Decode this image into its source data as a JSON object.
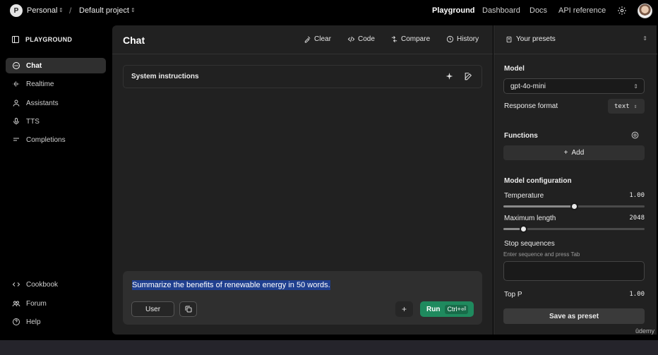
{
  "topbar": {
    "org_initial": "P",
    "org_name": "Personal",
    "separator": "/",
    "project_name": "Default project",
    "nav": [
      "Playground",
      "Dashboard",
      "Docs",
      "API reference"
    ]
  },
  "sidebar": {
    "title": "PLAYGROUND",
    "items": [
      {
        "label": "Chat",
        "icon": "chat-bubble-icon",
        "active": true
      },
      {
        "label": "Realtime",
        "icon": "waveform-icon"
      },
      {
        "label": "Assistants",
        "icon": "assistant-icon"
      },
      {
        "label": "TTS",
        "icon": "microphone-icon"
      },
      {
        "label": "Completions",
        "icon": "lines-icon"
      }
    ],
    "bottom_items": [
      {
        "label": "Cookbook",
        "icon": "code-icon"
      },
      {
        "label": "Forum",
        "icon": "people-icon"
      },
      {
        "label": "Help",
        "icon": "help-icon"
      }
    ]
  },
  "main": {
    "title": "Chat",
    "header_buttons": [
      "Clear",
      "Code",
      "Compare",
      "History"
    ],
    "system_label": "System instructions",
    "composer_text": "Summarize the benefits of renewable energy in 50 words.",
    "role_label": "User",
    "add_symbol": "+",
    "run_label": "Run",
    "run_shortcut": "Ctrl+⏎"
  },
  "right": {
    "presets_label": "Your presets",
    "model_label": "Model",
    "model_value": "gpt-4o-mini",
    "response_format_label": "Response format",
    "response_format_value": "text",
    "functions_label": "Functions",
    "add_label": "Add",
    "config_label": "Model configuration",
    "temperature_label": "Temperature",
    "temperature_value": "1.00",
    "temperature_fraction": 0.5,
    "max_length_label": "Maximum length",
    "max_length_value": "2048",
    "max_length_fraction": 0.14,
    "stop_label": "Stop sequences",
    "stop_hint": "Enter sequence and press Tab",
    "top_p_label": "Top P",
    "top_p_value": "1.00",
    "save_label": "Save as preset"
  },
  "watermark": "ûdemy",
  "colors": {
    "accent_green": "#1f8a5e",
    "selection_blue": "#1f3f8f",
    "panel_bg": "#212121"
  }
}
